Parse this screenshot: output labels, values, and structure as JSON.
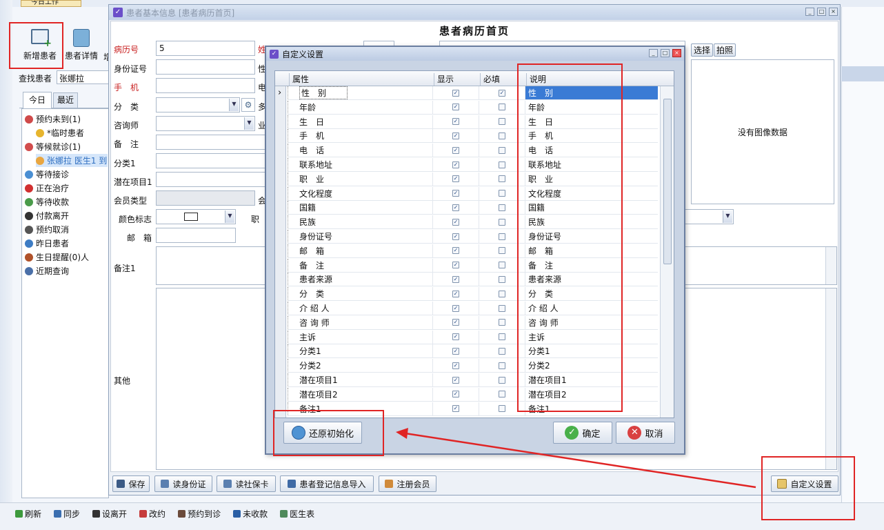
{
  "app": {
    "top_tab_fragment": "今日工作"
  },
  "toolbar": {
    "add_patient": "新增患者",
    "patient_detail": "患者详情",
    "extra_fragment": "增"
  },
  "left_panel": {
    "search_label": "查找患者",
    "search_value": "张娜拉",
    "tabs": [
      "今日",
      "最近"
    ],
    "tree": [
      {
        "label": "预约未到(1)",
        "icon": "calendar-icon",
        "level": 0
      },
      {
        "label": "*临时患者",
        "icon": "smile-icon",
        "level": 1
      },
      {
        "label": "等候就诊(1)",
        "icon": "clock-icon",
        "level": 0
      },
      {
        "label": "张娜拉 医生1 到",
        "icon": "person-icon",
        "level": 1,
        "selected": true
      },
      {
        "label": "等待接诊",
        "icon": "people-icon",
        "level": 0
      },
      {
        "label": "正在治疗",
        "icon": "drop-icon",
        "level": 0
      },
      {
        "label": "等待收款",
        "icon": "money-icon",
        "level": 0
      },
      {
        "label": "付款离开",
        "icon": "walk-icon",
        "level": 0
      },
      {
        "label": "预约取消",
        "icon": "cancel-icon",
        "level": 0
      },
      {
        "label": "昨日患者",
        "icon": "eye-icon",
        "level": 0
      },
      {
        "label": "生日提醒(0)人",
        "icon": "cake-icon",
        "level": 0
      },
      {
        "label": "近期查询",
        "icon": "search-icon",
        "level": 0
      }
    ]
  },
  "patient_window": {
    "title": "患者基本信息 [患者病历首页]",
    "heading": "患者病历首页",
    "fields": {
      "record_no_label": "病历号",
      "record_no_value": "5",
      "name_frag": "姓",
      "id_label": "身份证号",
      "gender_frag": "性",
      "phone_label": "手　机",
      "tel_frag": "电",
      "category_label": "分　类",
      "more_frag": "多",
      "consultant_label": "咨询师",
      "job_frag": "业",
      "remark_label": "备　注",
      "category1_label": "分类1",
      "potential_label": "潜在项目1",
      "member_type_label": "会员类型",
      "member_frag": "会",
      "color_label": "颜色标志",
      "duty_frag": "职",
      "email_label": "邮　箱",
      "remark1_label": "备注1",
      "other_label": "其他"
    },
    "photo_select": "选择",
    "photo_take": "拍照",
    "no_image": "没有图像数据",
    "bottom_buttons": [
      "保存",
      "读身份证",
      "读社保卡",
      "患者登记信息导入",
      "注册会员"
    ],
    "custom_settings": "自定义设置"
  },
  "dialog": {
    "title": "自定义设置",
    "columns": [
      "属性",
      "显示",
      "必填",
      "说明"
    ],
    "rows": [
      {
        "attr": "性　别",
        "show": true,
        "required": true,
        "desc": "性　别",
        "selected": true
      },
      {
        "attr": "年龄",
        "show": true,
        "required": false,
        "desc": "年龄"
      },
      {
        "attr": "生　日",
        "show": true,
        "required": false,
        "desc": "生　日"
      },
      {
        "attr": "手　机",
        "show": true,
        "required": false,
        "desc": "手　机"
      },
      {
        "attr": "电　话",
        "show": true,
        "required": false,
        "desc": "电　话"
      },
      {
        "attr": "联系地址",
        "show": true,
        "required": false,
        "desc": "联系地址"
      },
      {
        "attr": "职　业",
        "show": true,
        "required": false,
        "desc": "职　业"
      },
      {
        "attr": "文化程度",
        "show": true,
        "required": false,
        "desc": "文化程度"
      },
      {
        "attr": "国籍",
        "show": true,
        "required": false,
        "desc": "国籍"
      },
      {
        "attr": "民族",
        "show": true,
        "required": false,
        "desc": "民族"
      },
      {
        "attr": "身份证号",
        "show": true,
        "required": false,
        "desc": "身份证号"
      },
      {
        "attr": "邮　箱",
        "show": true,
        "required": false,
        "desc": "邮　箱"
      },
      {
        "attr": "备　注",
        "show": true,
        "required": false,
        "desc": "备　注"
      },
      {
        "attr": "患者来源",
        "show": true,
        "required": false,
        "desc": "患者来源"
      },
      {
        "attr": "分　类",
        "show": true,
        "required": false,
        "desc": "分　类"
      },
      {
        "attr": "介 绍 人",
        "show": true,
        "required": false,
        "desc": "介 绍 人"
      },
      {
        "attr": "咨 询 师",
        "show": true,
        "required": false,
        "desc": "咨 询 师"
      },
      {
        "attr": "主诉",
        "show": true,
        "required": false,
        "desc": "主诉"
      },
      {
        "attr": "分类1",
        "show": true,
        "required": false,
        "desc": "分类1"
      },
      {
        "attr": "分类2",
        "show": true,
        "required": false,
        "desc": "分类2"
      },
      {
        "attr": "潜在项目1",
        "show": true,
        "required": false,
        "desc": "潜在项目1"
      },
      {
        "attr": "潜在项目2",
        "show": true,
        "required": false,
        "desc": "潜在项目2"
      },
      {
        "attr": "备注1",
        "show": true,
        "required": false,
        "desc": "备注1"
      }
    ],
    "reset_button": "还原初始化",
    "ok_button": "确定",
    "cancel_button": "取消"
  },
  "status_bar": [
    "刷新",
    "同步",
    "设离开",
    "改约",
    "预约到诊",
    "未收款",
    "医生表"
  ],
  "colors": {
    "selected_row": "#3a7bd5",
    "label_red": "#c81e1e",
    "annotation_red": "#e02424",
    "title_bar": "#c7d5ea"
  }
}
